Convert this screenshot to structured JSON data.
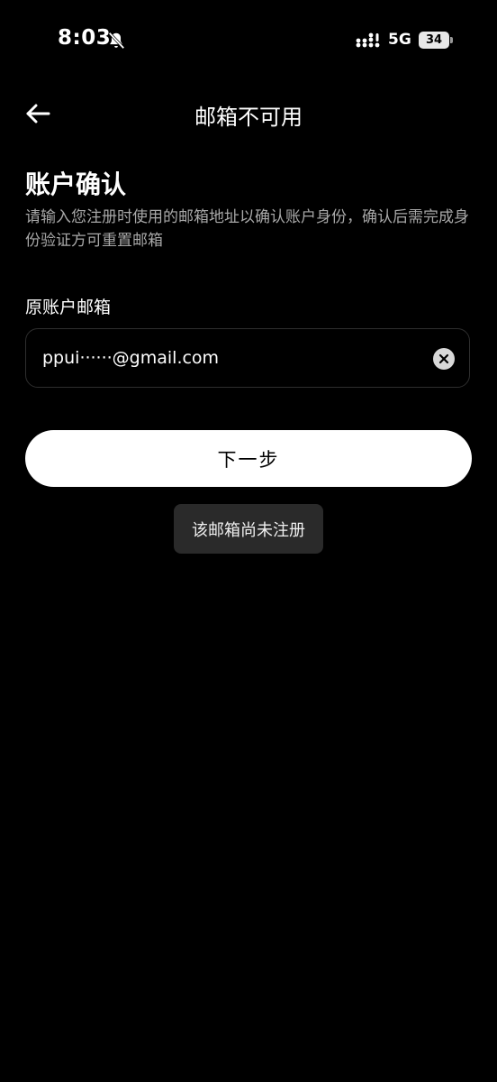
{
  "status_bar": {
    "time": "8:03",
    "network": "5G",
    "battery": "34"
  },
  "nav": {
    "title": "邮箱不可用"
  },
  "content": {
    "title": "账户确认",
    "description": "请输入您注册时使用的邮箱地址以确认账户身份，确认后需完成身份验证方可重置邮箱",
    "field_label": "原账户邮箱",
    "email_value": "ppui······@gmail.com",
    "next_label": "下一步",
    "toast": "该邮箱尚未注册"
  },
  "colors": {
    "background": "#000000",
    "primary_button": "#ffffff",
    "toast_bg": "#2a2a2a"
  }
}
